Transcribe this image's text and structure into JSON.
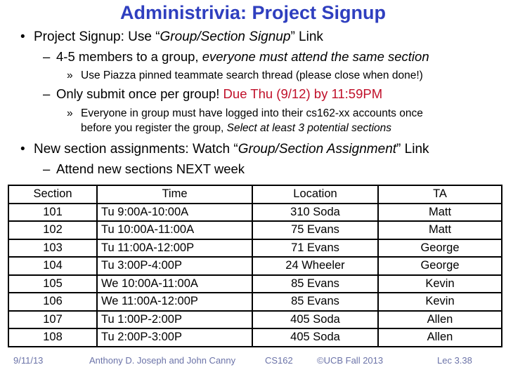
{
  "slide": {
    "title": "Administrivia: Project Signup"
  },
  "bullets": {
    "b1": {
      "marker": "•",
      "prefix": "Project Signup: Use “",
      "emph": "Group/Section Signup",
      "suffix": "” Link"
    },
    "b1_1": {
      "marker": "–",
      "prefix": "4-5 members to a group, ",
      "emph": "everyone must attend the same section"
    },
    "b1_1_1": {
      "marker": "»",
      "text": "Use Piazza pinned teammate search thread (please close when done!)"
    },
    "b1_2": {
      "marker": "–",
      "prefix": "Only submit once per group! ",
      "highlight": "Due Thu (9/12) by 11:59PM"
    },
    "b1_2_1": {
      "marker": "»",
      "line1": "Everyone in group must have logged into their cs162-xx accounts once",
      "line2_prefix": "before you register the group, ",
      "line2_emph": "Select at least 3 potential sections"
    },
    "b2": {
      "marker": "•",
      "prefix": "New section assignments: Watch “",
      "emph": "Group/Section Assignment",
      "suffix": "” Link"
    },
    "b2_1": {
      "marker": "–",
      "text": "Attend new sections NEXT week"
    }
  },
  "table": {
    "headers": [
      "Section",
      "Time",
      "Location",
      "TA"
    ],
    "rows": [
      [
        "101",
        "Tu 9:00A-10:00A",
        "310 Soda",
        "Matt"
      ],
      [
        "102",
        "Tu 10:00A-11:00A",
        "75 Evans",
        "Matt"
      ],
      [
        "103",
        "Tu 11:00A-12:00P",
        "71 Evans",
        "George"
      ],
      [
        "104",
        "Tu 3:00P-4:00P",
        "24 Wheeler",
        "George"
      ],
      [
        "105",
        "We 10:00A-11:00A",
        "85 Evans",
        "Kevin"
      ],
      [
        "106",
        "We 11:00A-12:00P",
        "85 Evans",
        "Kevin"
      ],
      [
        "107",
        "Tu 1:00P-2:00P",
        "405 Soda",
        "Allen"
      ],
      [
        "108",
        "Tu 2:00P-3:00P",
        "405 Soda",
        "Allen"
      ]
    ]
  },
  "footer": {
    "date": "9/11/13",
    "authors": "Anthony D. Joseph and John Canny",
    "course": "CS162",
    "copyright": "©UCB Fall 2013",
    "slide_number": "Lec 3.38"
  },
  "colors": {
    "title": "#2f3fbf",
    "deadline": "#c0102a",
    "footer": "#6b73a8"
  }
}
